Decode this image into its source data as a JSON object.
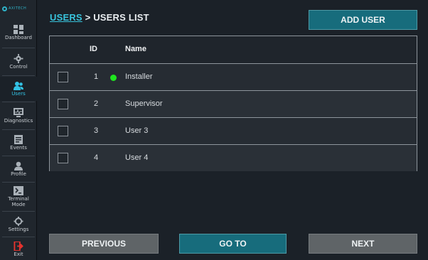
{
  "logo": {
    "text": "AXITECH"
  },
  "sidebar": {
    "items": [
      {
        "label": "Dashboard",
        "icon": "dashboard-icon",
        "active": false
      },
      {
        "label": "Control",
        "icon": "gear-icon",
        "active": false
      },
      {
        "label": "Users",
        "icon": "users-icon",
        "active": true
      },
      {
        "label": "Diagnostics",
        "icon": "diagnostics-icon",
        "active": false
      },
      {
        "label": "Events",
        "icon": "events-icon",
        "active": false
      },
      {
        "label": "Profile",
        "icon": "profile-icon",
        "active": false
      },
      {
        "label": "Terminal Mode",
        "icon": "terminal-icon",
        "active": false
      },
      {
        "label": "Settings",
        "icon": "settings-icon",
        "active": false
      },
      {
        "label": "Exit",
        "icon": "exit-icon",
        "active": false
      }
    ]
  },
  "header": {
    "breadcrumb_link": "USERS",
    "breadcrumb_sep": " > ",
    "breadcrumb_current": "USERS LIST",
    "add_user_label": "ADD USER"
  },
  "table": {
    "columns": [
      "ID",
      "Name"
    ],
    "rows": [
      {
        "id": "1",
        "name": "Installer",
        "online": true
      },
      {
        "id": "2",
        "name": "Supervisor",
        "online": false
      },
      {
        "id": "3",
        "name": "User 3",
        "online": false
      },
      {
        "id": "4",
        "name": "User 4",
        "online": false
      }
    ]
  },
  "footer": {
    "previous_label": "PREVIOUS",
    "goto_label": "GO TO",
    "next_label": "NEXT"
  },
  "colors": {
    "accent": "#176c7c",
    "link": "#38c4dd",
    "active_nav": "#33c3e6",
    "status_online": "#1fe61f",
    "background": "#1b2128"
  }
}
